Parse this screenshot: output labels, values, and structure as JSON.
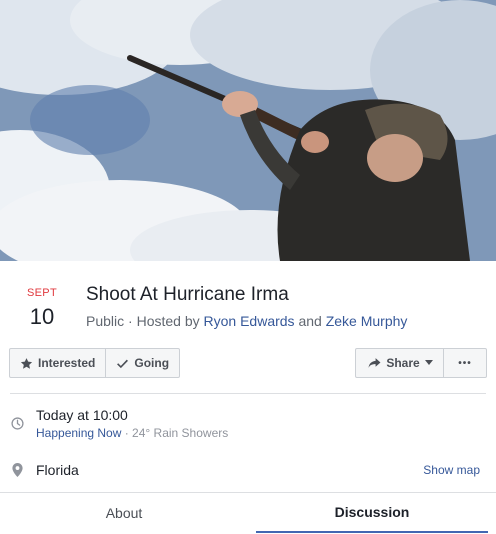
{
  "event": {
    "date_month": "SEPT",
    "date_day": "10",
    "title": "Shoot At Hurricane Irma",
    "privacy": "Public",
    "hosted_by_prefix": " · Hosted by ",
    "host_1": "Ryon Edwards",
    "and_word": " and ",
    "host_2": "Zeke Murphy"
  },
  "actions": {
    "interested_label": "Interested",
    "going_label": "Going",
    "share_label": "Share",
    "more_label": "•••"
  },
  "details": {
    "time_label": "Today at 10:00",
    "status": "Happening Now",
    "weather": " · 24° Rain Showers",
    "location": "Florida",
    "show_map_label": "Show map"
  },
  "tabs": [
    {
      "label": "About"
    },
    {
      "label": "Discussion"
    }
  ],
  "colors": {
    "accent": "#4267b2",
    "link": "#365899",
    "date_month": "#e0393e"
  }
}
